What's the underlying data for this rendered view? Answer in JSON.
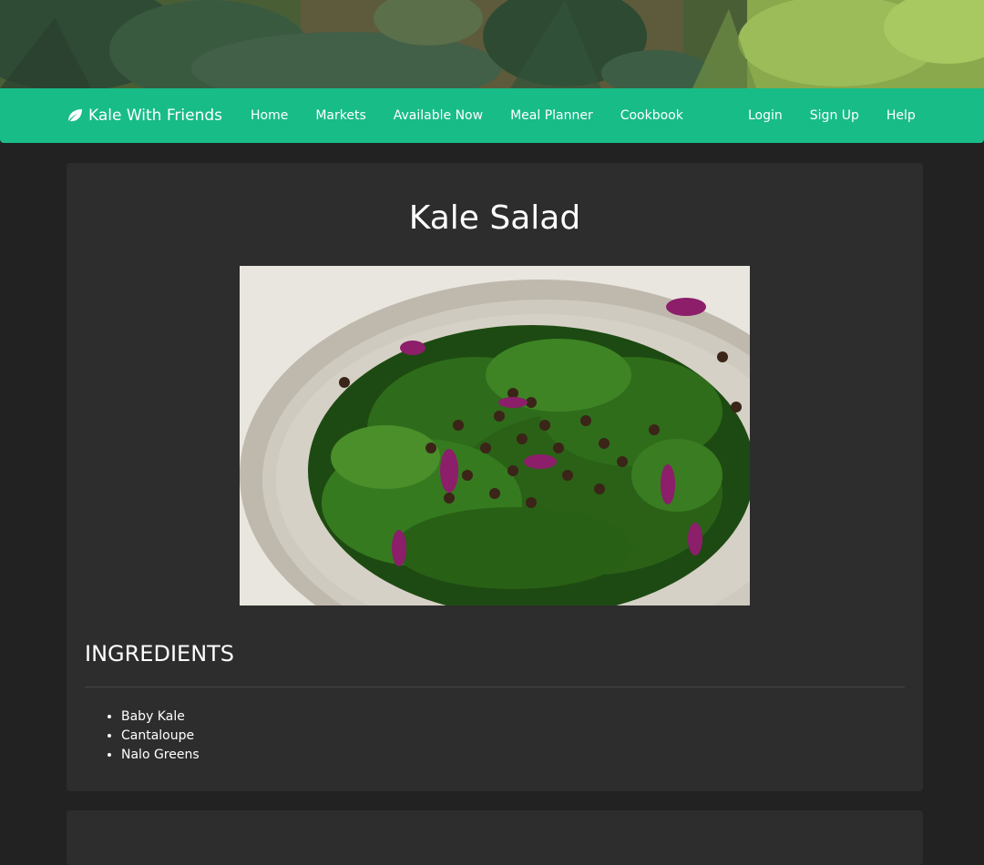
{
  "navbar": {
    "brand": "Kale With Friends",
    "brand_icon": "leaf-icon",
    "left_items": [
      "Home",
      "Markets",
      "Available Now",
      "Meal Planner",
      "Cookbook"
    ],
    "right_items": [
      "Login",
      "Sign Up",
      "Help"
    ],
    "accent_color": "#18bc87"
  },
  "recipe": {
    "title": "Kale Salad",
    "ingredients_heading": "INGREDIENTS",
    "ingredients": [
      "Baby Kale",
      "Cantaloupe",
      "Nalo Greens"
    ]
  },
  "colors": {
    "page_background": "#222222",
    "card_background": "#2d2d2d"
  }
}
